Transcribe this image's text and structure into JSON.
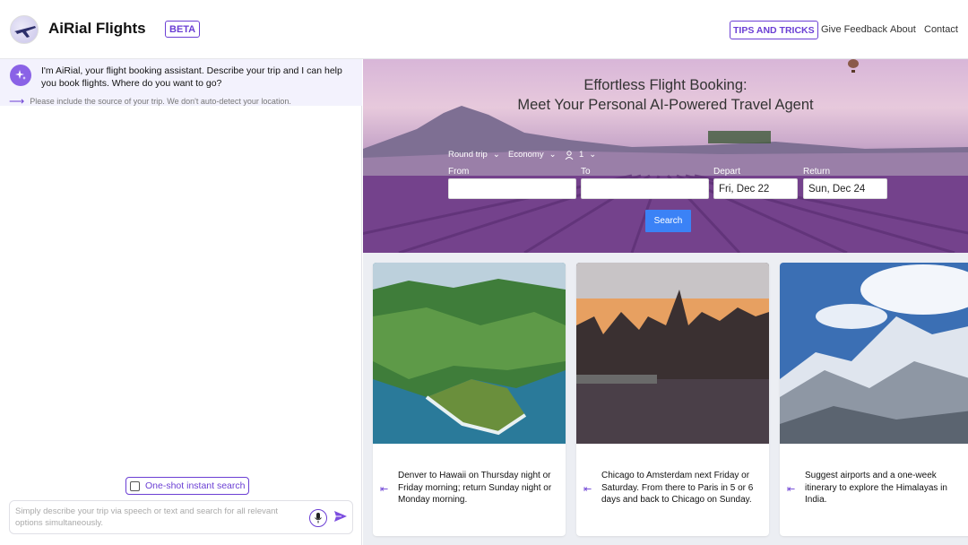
{
  "header": {
    "brand": "AiRial Flights",
    "beta": "BETA",
    "nav": {
      "tips": "TIPS AND TRICKS",
      "feedback": "Give Feedback",
      "about": "About",
      "contact": "Contact"
    }
  },
  "assistant": {
    "message": "I'm AiRial, your flight booking assistant. Describe your trip and I can help you book flights. Where do you want to go?",
    "hint": "Please include the source of your trip. We don't auto-detect your location."
  },
  "chat": {
    "oneshot_label": "One-shot instant search",
    "placeholder": "Simply describe your trip via speech or text and search for all relevant options simultaneously."
  },
  "hero": {
    "title_line1": "Effortless Flight Booking:",
    "title_line2": "Meet Your Personal AI-Powered Travel Agent"
  },
  "search_form": {
    "trip_type": "Round trip",
    "cabin_class": "Economy",
    "passengers": "1",
    "from_label": "From",
    "to_label": "To",
    "depart_label": "Depart",
    "return_label": "Return",
    "from_value": "",
    "to_value": "",
    "depart_value": "Fri, Dec 22",
    "return_value": "Sun, Dec 24",
    "search_label": "Search"
  },
  "cards": [
    {
      "text": "Denver to Hawaii on Thursday night or Friday morning; return Sunday night or Monday morning."
    },
    {
      "text": "Chicago to Amsterdam next Friday or Saturday. From there to Paris in 5 or 6 days and back to Chicago on Sunday."
    },
    {
      "text": "Suggest airports and a one-week itinerary to explore the Himalayas in India."
    }
  ],
  "colors": {
    "accent": "#6b3fd4",
    "search_button": "#3b82f6",
    "assistant_bg": "#f3f2fd"
  }
}
